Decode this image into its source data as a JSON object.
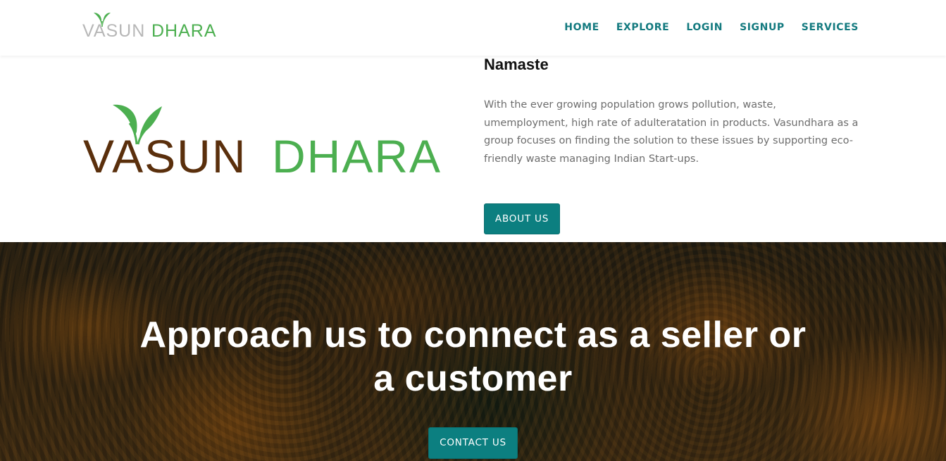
{
  "header": {
    "brand": {
      "part1": "VASUN",
      "part2": "DHARA"
    },
    "nav": [
      "HOME",
      "EXPLORE",
      "LOGIN",
      "SIGNUP",
      "SERVICES"
    ]
  },
  "about": {
    "logo": {
      "part1": "VASUN",
      "part2": "DHARA"
    },
    "title": "Namaste",
    "text": "With the ever growing population grows pollution, waste, umemployment, high rate of adulteratation in products. Vasundhara as a group focuses on finding the solution to these issues by supporting eco-friendly waste managing Indian Start-ups.",
    "button": "ABOUT US"
  },
  "hero": {
    "line1": "Approach us to connect as a seller or",
    "line2": "a customer",
    "button": "CONTACT US"
  },
  "colors": {
    "accent": "#0c7f80",
    "nav_text": "#137a7f",
    "logo_brown": "#5a2f0c",
    "logo_green": "#4caf50"
  },
  "icons": {
    "brand_mark": "leaf-icon"
  }
}
